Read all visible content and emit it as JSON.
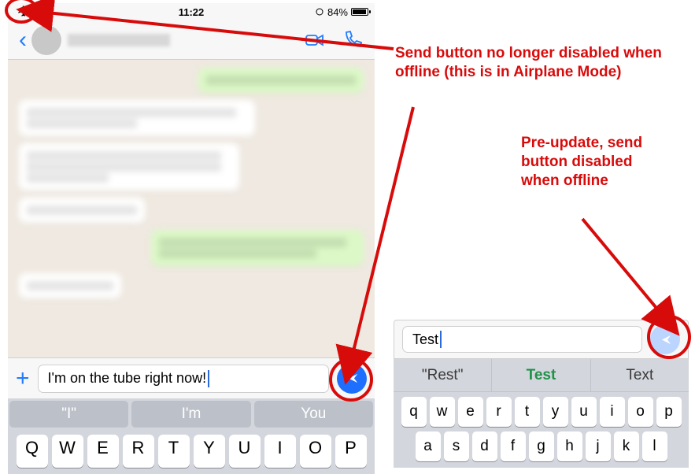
{
  "status": {
    "time": "11:22",
    "battery": "84%"
  },
  "left": {
    "input_value": "I'm on the tube right now!",
    "suggestions": [
      "I",
      "I'm",
      "You"
    ],
    "keys_row1": [
      "Q",
      "W",
      "E",
      "R",
      "T",
      "Y",
      "U",
      "I",
      "O",
      "P"
    ]
  },
  "right": {
    "input_value": "Test",
    "suggestions": [
      "Rest",
      "Test",
      "Text"
    ],
    "keys_row1": [
      "q",
      "w",
      "e",
      "r",
      "t",
      "y",
      "u",
      "i",
      "o",
      "p"
    ],
    "keys_row2": [
      "a",
      "s",
      "d",
      "f",
      "g",
      "h",
      "j",
      "k",
      "l"
    ]
  },
  "annotations": {
    "a1": "Send button no longer disabled when offline (this is in Airplane Mode)",
    "a2": "Pre-update, send button disabled when offline"
  }
}
